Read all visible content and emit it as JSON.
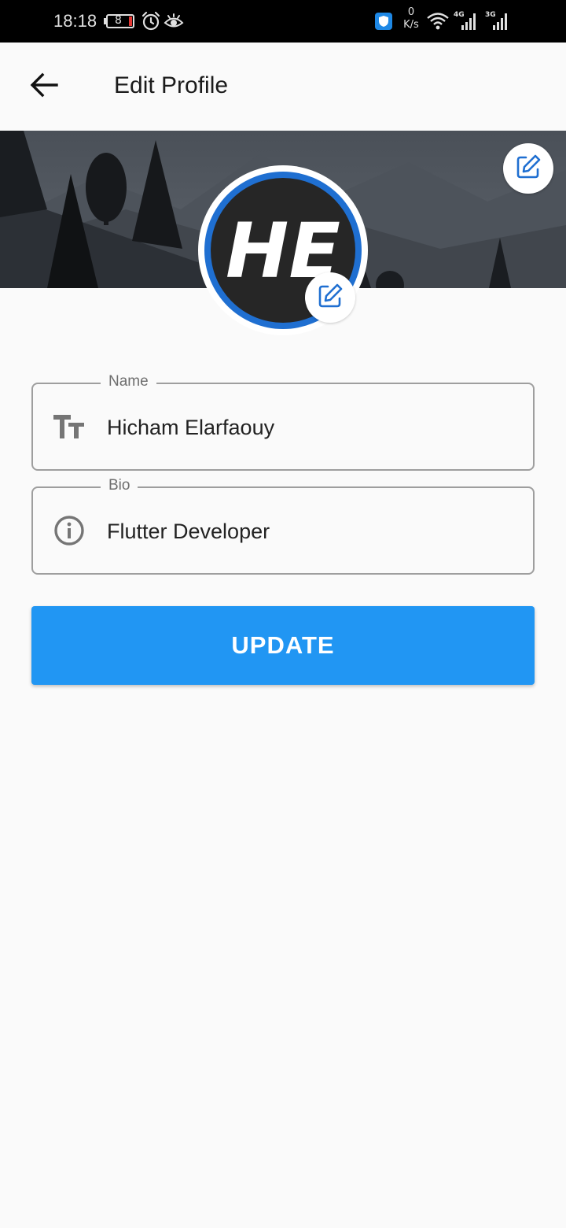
{
  "status_bar": {
    "time": "18:18",
    "battery": "8",
    "net_speed_value": "0",
    "net_speed_unit": "K/s",
    "network_label_1": "4G",
    "network_label_2": "3G",
    "icons": [
      "battery-icon",
      "alarm-icon",
      "eye-icon",
      "shield-icon",
      "wifi-icon",
      "signal-icon"
    ]
  },
  "app_bar": {
    "title": "Edit Profile",
    "back_icon": "arrow-back-icon"
  },
  "profile": {
    "avatar_text": "HE",
    "cover_edit_icon": "edit-icon",
    "avatar_edit_icon": "edit-icon"
  },
  "form": {
    "name": {
      "label": "Name",
      "value": "Hicham Elarfaouy",
      "icon": "text-fields-icon"
    },
    "bio": {
      "label": "Bio",
      "value": "Flutter Developer",
      "icon": "info-icon"
    }
  },
  "actions": {
    "update_label": "UPDATE"
  },
  "colors": {
    "primary": "#2196f3",
    "avatar_ring": "#1f6fd1",
    "border": "#9e9e9e",
    "background": "#fafafa"
  }
}
